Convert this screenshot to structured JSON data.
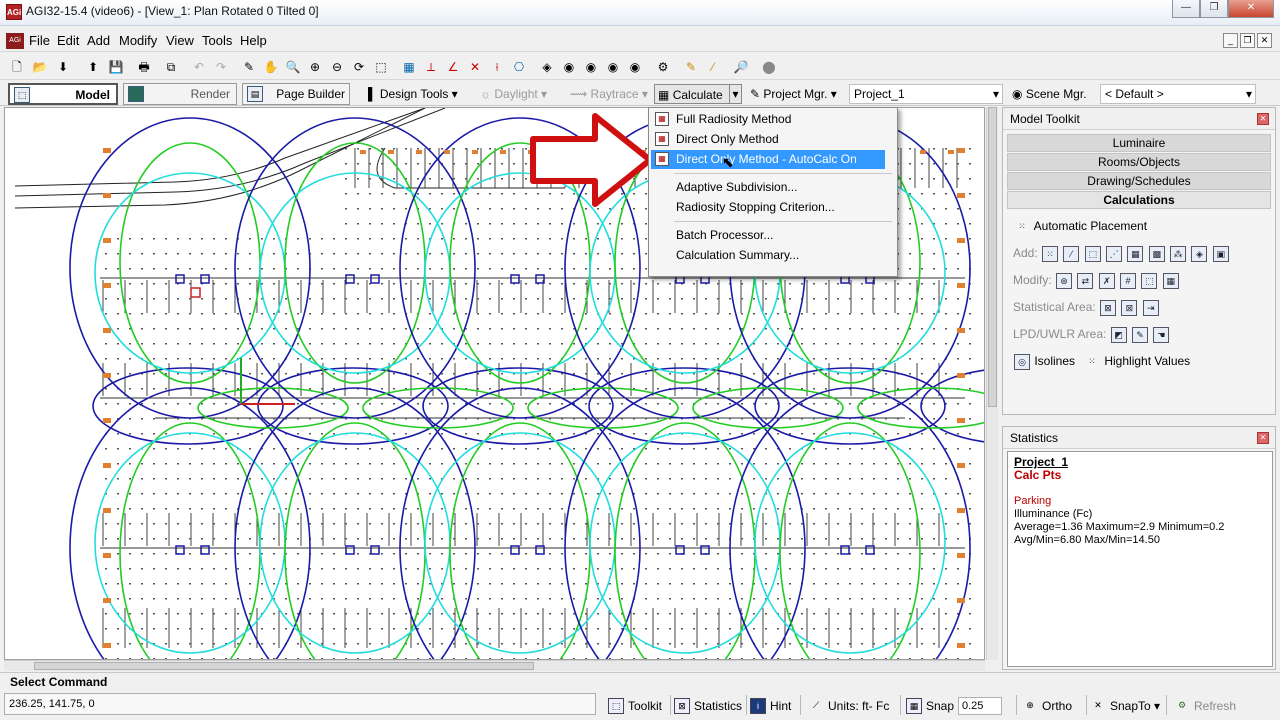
{
  "titlebar": {
    "app_icon_text": "AGi",
    "title": "AGI32-15.4 (video6) - [View_1: Plan Rotated 0 Tilted 0]"
  },
  "menubar": {
    "items": [
      "File",
      "Edit",
      "Add",
      "Modify",
      "View",
      "Tools",
      "Help"
    ]
  },
  "toolbar2": {
    "tabs": [
      {
        "label": "Model"
      },
      {
        "label": "Render"
      },
      {
        "label": "Page Builder"
      }
    ],
    "design_tools": "Design Tools",
    "daylight": "Daylight",
    "raytrace": "Raytrace",
    "calculate": "Calculate",
    "project_mgr": "Project Mgr.",
    "project_value": "Project_1",
    "scene_mgr": "Scene Mgr.",
    "scene_value": "< Default >"
  },
  "calculate_menu": {
    "items": [
      "Full Radiosity Method",
      "Direct Only Method",
      "Direct Only Method - AutoCalc On",
      "Adaptive Subdivision...",
      "Radiosity Stopping Criterion...",
      "Batch Processor...",
      "Calculation Summary..."
    ],
    "highlighted": "Direct Only Method - AutoCalc On"
  },
  "model_toolkit": {
    "title": "Model Toolkit",
    "tabs": [
      "Luminaire",
      "Rooms/Objects",
      "Drawing/Schedules",
      "Calculations"
    ],
    "active_tab": "Calculations",
    "automatic_placement": "Automatic Placement",
    "add_label": "Add:",
    "modify_label": "Modify:",
    "statistical_area_label": "Statistical Area:",
    "lpd_label": "LPD/UWLR Area:",
    "isolines": "Isolines",
    "highlight_values": "Highlight Values"
  },
  "statistics": {
    "title": "Statistics",
    "project": "Project_1",
    "calc_pts": "Calc Pts",
    "area_name": "Parking",
    "quantity": "Illuminance (Fc)",
    "line1": "Average=1.36   Maximum=2.9   Minimum=0.2",
    "line2": "Avg/Min=6.80   Max/Min=14.50"
  },
  "command": {
    "label": "Select Command",
    "coords": "236.25, 141.75, 0"
  },
  "statusbar": {
    "toolkit": "Toolkit",
    "statistics": "Statistics",
    "hint": "Hint",
    "units": "Units: ft- Fc",
    "snap": "Snap",
    "snap_value": "0.25",
    "ortho": "Ortho",
    "snapto": "SnapTo",
    "refresh": "Refresh"
  },
  "colors": {
    "iso_dark": "#1a1aa8",
    "iso_green": "#22cc22",
    "iso_cyan": "#22dddd",
    "highlight": "#3399ff",
    "arrow_red": "#e01010"
  }
}
